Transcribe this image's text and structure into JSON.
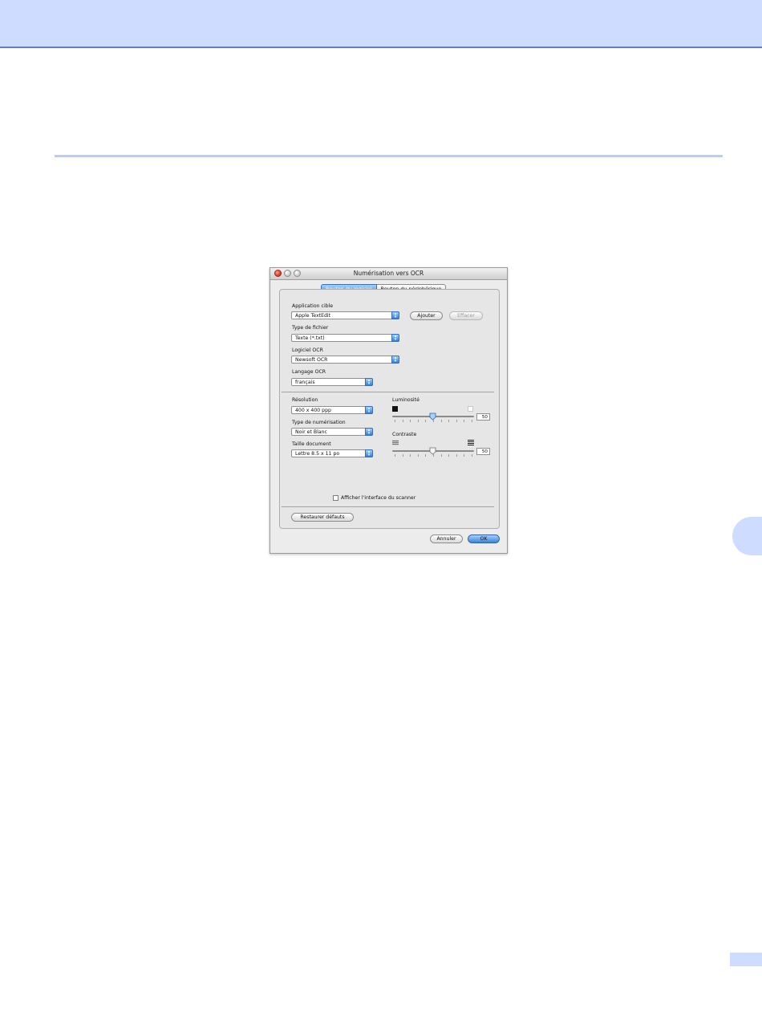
{
  "window": {
    "title": "Numérisation vers OCR"
  },
  "tabs": {
    "software": "Bouton du logiciel",
    "device": "Bouton du périphérique"
  },
  "target_app": {
    "label": "Application cible",
    "value": "Apple TextEdit",
    "add_label": "Ajouter",
    "delete_label": "Effacer"
  },
  "file_type": {
    "label": "Type de fichier",
    "value": "Texte (*.txt)"
  },
  "ocr_software": {
    "label": "Logiciel OCR",
    "value": "Newsoft OCR"
  },
  "ocr_language": {
    "label": "Langage OCR",
    "value": "français"
  },
  "resolution": {
    "label": "Résolution",
    "value": "400 x 400 ppp"
  },
  "scan_type": {
    "label": "Type de numérisation",
    "value": "Noir et Blanc"
  },
  "doc_size": {
    "label": "Taille document",
    "value": "Lettre  8.5 x 11 po"
  },
  "brightness": {
    "label": "Luminosité",
    "value": "50"
  },
  "contrast": {
    "label": "Contraste",
    "value": "50"
  },
  "show_scanner_interface": {
    "label": "Afficher l'interface du scanner",
    "checked": false
  },
  "restore_defaults": "Restaurer défauts",
  "cancel": "Annuler",
  "ok": "OK"
}
